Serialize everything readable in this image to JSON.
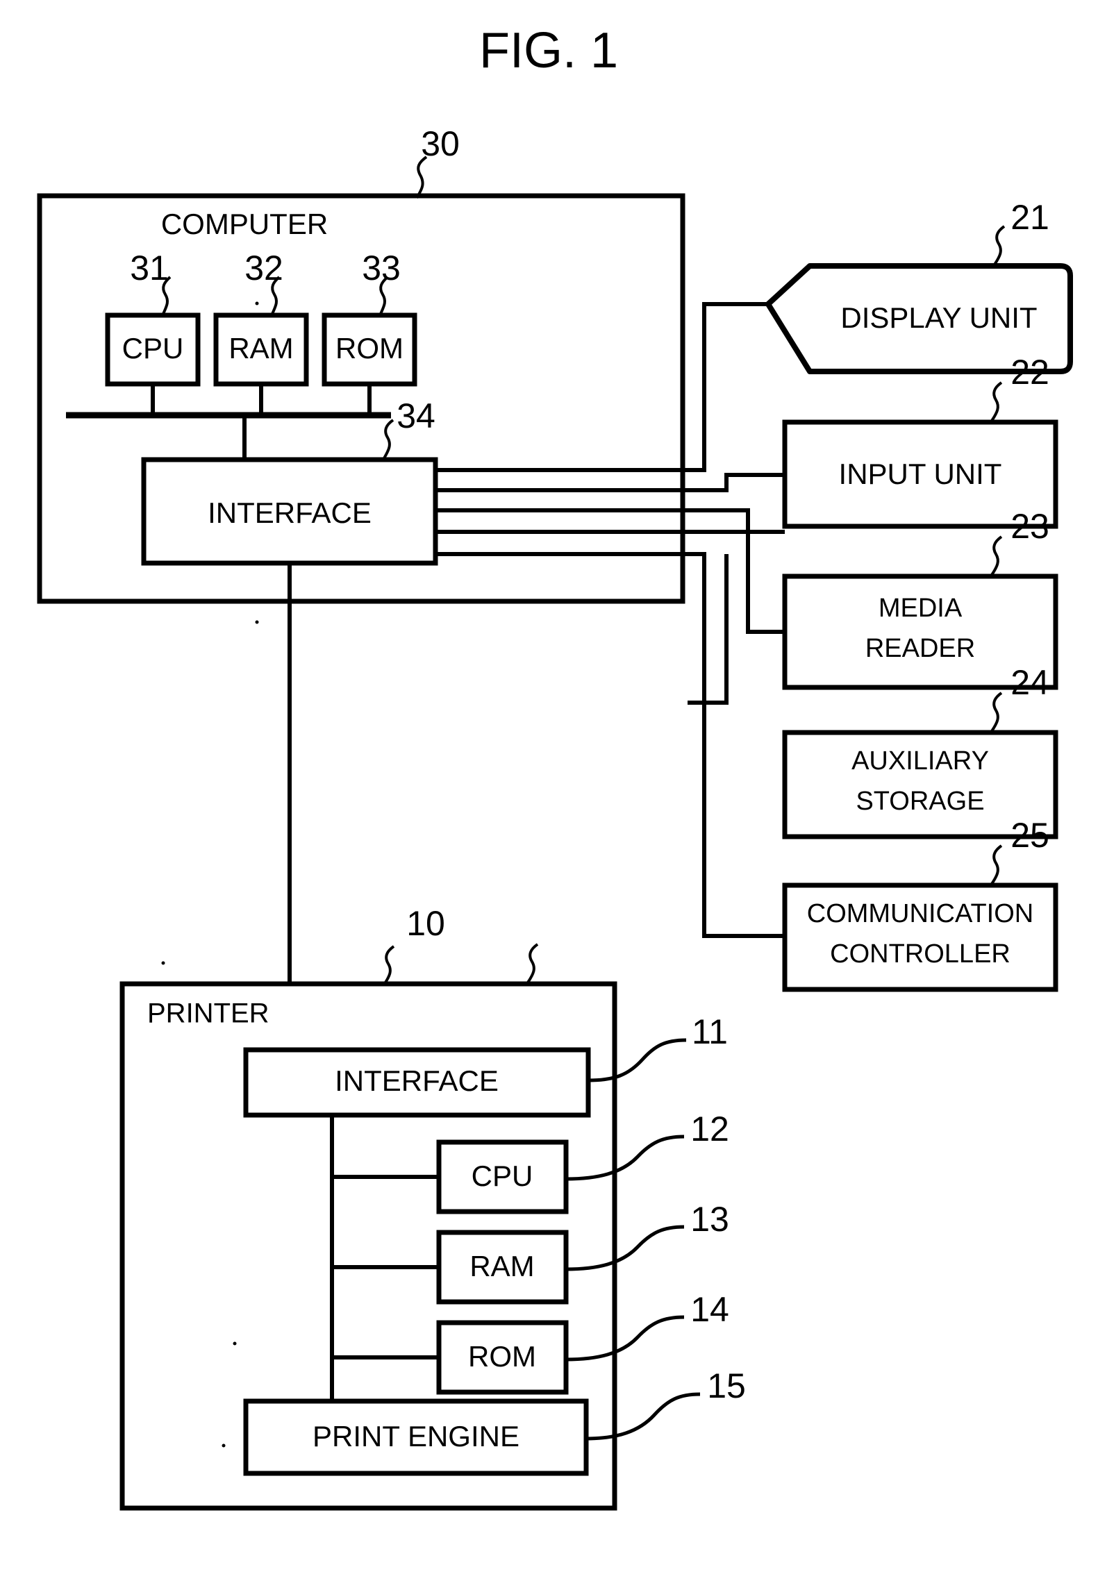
{
  "figure": {
    "title": "FIG. 1",
    "domain_kind": "patent-block-diagram"
  },
  "computer": {
    "label": "COMPUTER",
    "ref": "30",
    "bus_label": "",
    "components": [
      {
        "label": "CPU",
        "ref": "31"
      },
      {
        "label": "RAM",
        "ref": "32"
      },
      {
        "label": "ROM",
        "ref": "33"
      }
    ],
    "interface": {
      "label": "INTERFACE",
      "ref": "34"
    }
  },
  "peripherals": [
    {
      "label": "DISPLAY UNIT",
      "ref": "21",
      "shape": "flag"
    },
    {
      "label": "INPUT UNIT",
      "ref": "22",
      "shape": "rect"
    },
    {
      "label_line1": "MEDIA",
      "label_line2": "READER",
      "ref": "23",
      "shape": "rect"
    },
    {
      "label_line1": "AUXILIARY",
      "label_line2": "STORAGE",
      "ref": "24",
      "shape": "rect"
    },
    {
      "label_line1": "COMMUNICATION",
      "label_line2": "CONTROLLER",
      "ref": "25",
      "shape": "rect"
    }
  ],
  "printer": {
    "label": "PRINTER",
    "ref": "10",
    "interface": {
      "label": "INTERFACE",
      "ref": "11"
    },
    "components": [
      {
        "label": "CPU",
        "ref": "12"
      },
      {
        "label": "RAM",
        "ref": "13"
      },
      {
        "label": "ROM",
        "ref": "14"
      }
    ],
    "engine": {
      "label": "PRINT ENGINE",
      "ref": "15"
    }
  },
  "colors": {
    "ink": "#000000",
    "paper": "#ffffff"
  }
}
